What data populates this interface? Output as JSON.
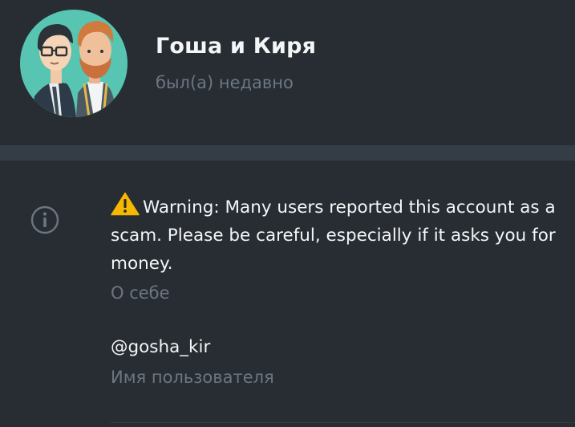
{
  "profile": {
    "name": "Гоша и Киря",
    "status": "был(а) недавно",
    "avatar_icon": "avatar-two-men-illustration"
  },
  "info": {
    "icon": "info-circle-icon",
    "bio": {
      "warning_icon": "warning-triangle-icon",
      "text": "Warning: Many users reported this account as a scam. Please be careful, especially if it asks you for money.",
      "caption": "О себе"
    },
    "username": {
      "value": "@gosha_kir",
      "caption": "Имя пользователя"
    }
  },
  "colors": {
    "background": "#282d33",
    "separator": "#343c46",
    "primary_text": "#f3f5f7",
    "secondary_text": "#6c7682",
    "avatar_bg": "#58c4b2",
    "warning": "#f5b800"
  }
}
